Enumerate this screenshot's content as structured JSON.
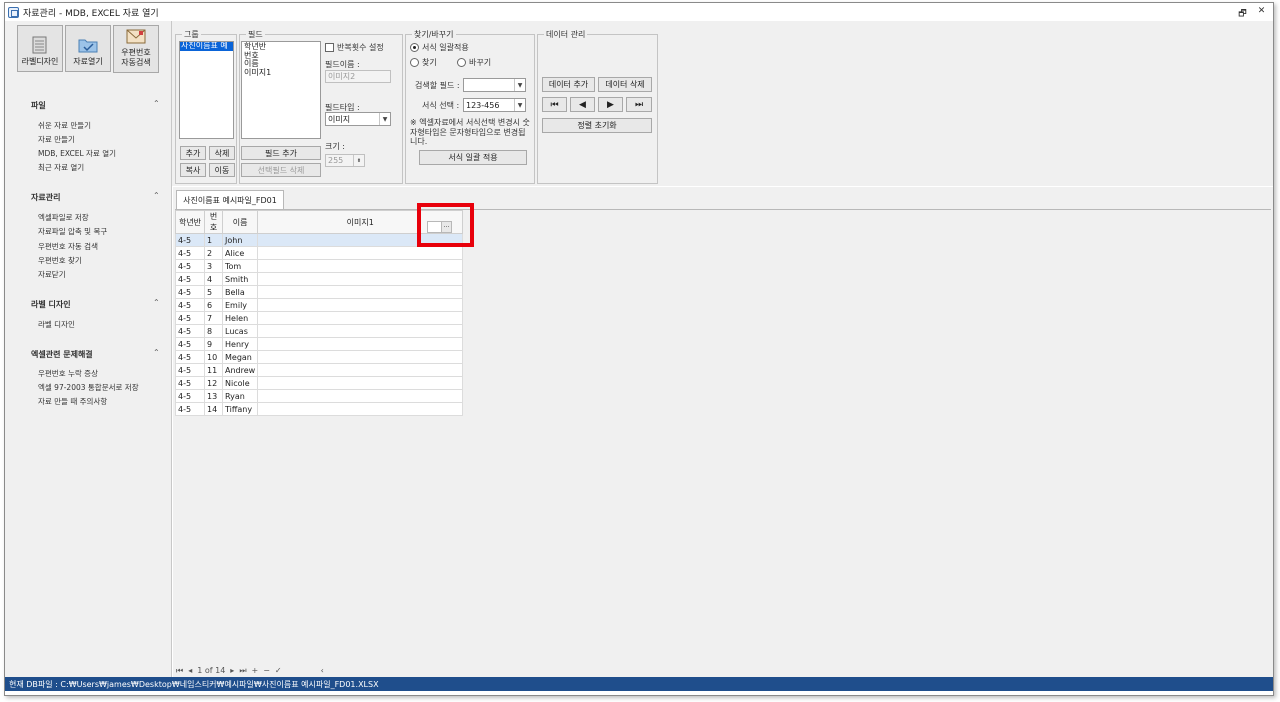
{
  "window": {
    "title": "자료관리 - MDB, EXCEL 자료 열기",
    "controls": [
      "restore",
      "close"
    ]
  },
  "toolbar": {
    "label_design": "라벨디자인",
    "open_data": "자료열기",
    "postal_search_line1": "우편번호",
    "postal_search_line2": "자동검색"
  },
  "sidebar": {
    "sections": [
      {
        "title": "파일",
        "items": [
          "쉬운 자료 만들기",
          "자료 만들기",
          "MDB, EXCEL 자료 열기",
          "최근 자료 열기"
        ]
      },
      {
        "title": "자료관리",
        "items": [
          "엑셀파일로 저장",
          "자료파일 압축 및 복구",
          "우편번호 자동 검색",
          "우편번호 찾기",
          "자료닫기"
        ]
      },
      {
        "title": "라벨 디자인",
        "items": [
          "라벨 디자인"
        ]
      },
      {
        "title": "엑셀관련 문제해결",
        "items": [
          "우편번호 누락 증상",
          "엑셀 97-2003 통합문서로 저장",
          "자료 만들 때 주의사항"
        ]
      }
    ]
  },
  "group_panel": {
    "title": "그룹",
    "items": [
      "사진이름표 예"
    ],
    "add": "추가",
    "delete": "삭제",
    "copy": "복사",
    "move": "이동"
  },
  "field_panel": {
    "title": "필드",
    "items": [
      "학년반",
      "번호",
      "이름",
      "이미지1"
    ],
    "repeat_label": "반복횟수 설정",
    "field_name_label": "필드이름 :",
    "field_name_value": "이미지2",
    "field_type_label": "필드타입 :",
    "field_type_value": "이미지",
    "size_label": "크기 :",
    "size_value": "255",
    "add_field": "필드 추가",
    "delete_field": "선택필드 삭제"
  },
  "find_panel": {
    "title": "찾기/바꾸기",
    "opt_format": "서식 일괄적용",
    "opt_find": "찾기",
    "opt_replace": "바꾸기",
    "search_field_label": "검색할 필드 :",
    "search_field_value": "",
    "format_select_label": "서식 선택 :",
    "format_select_value": "123-456",
    "note": "※ 엑셀자료에서 서식선택 변경시 숫자형타입은 문자형타입으로 변경됩니다.",
    "apply": "서식 일괄 적용"
  },
  "data_panel": {
    "title": "데이터 관리",
    "add": "데이터 추가",
    "delete": "데이터 삭제",
    "nav_icons": [
      "first-icon",
      "prev-icon",
      "next-icon",
      "last-icon"
    ],
    "reset": "정렬 초기화"
  },
  "tab": {
    "label": "사진이름표 예시파일_FD01"
  },
  "grid": {
    "headers": [
      "학년반",
      "번호",
      "이름",
      "이미지1"
    ],
    "rows": [
      [
        "4-5",
        "1",
        "John",
        ""
      ],
      [
        "4-5",
        "2",
        "Alice",
        ""
      ],
      [
        "4-5",
        "3",
        "Tom",
        ""
      ],
      [
        "4-5",
        "4",
        "Smith",
        ""
      ],
      [
        "4-5",
        "5",
        "Bella",
        ""
      ],
      [
        "4-5",
        "6",
        "Emily",
        ""
      ],
      [
        "4-5",
        "7",
        "Helen",
        ""
      ],
      [
        "4-5",
        "8",
        "Lucas",
        ""
      ],
      [
        "4-5",
        "9",
        "Henry",
        ""
      ],
      [
        "4-5",
        "10",
        "Megan",
        ""
      ],
      [
        "4-5",
        "11",
        "Andrew",
        ""
      ],
      [
        "4-5",
        "12",
        "Nicole",
        ""
      ],
      [
        "4-5",
        "13",
        "Ryan",
        ""
      ],
      [
        "4-5",
        "14",
        "Tiffany",
        ""
      ]
    ],
    "ellipsis": "···"
  },
  "navigator": {
    "page": "1 of 14"
  },
  "status": {
    "text": "현재 DB파일 : C:₩Users₩james₩Desktop₩네임스티커₩예시파일₩사진이름표 예시파일_FD01.XLSX"
  },
  "colors": {
    "status_bg": "#1f4e8c",
    "highlight": "#e8000b",
    "selection": "#0a64d8"
  }
}
